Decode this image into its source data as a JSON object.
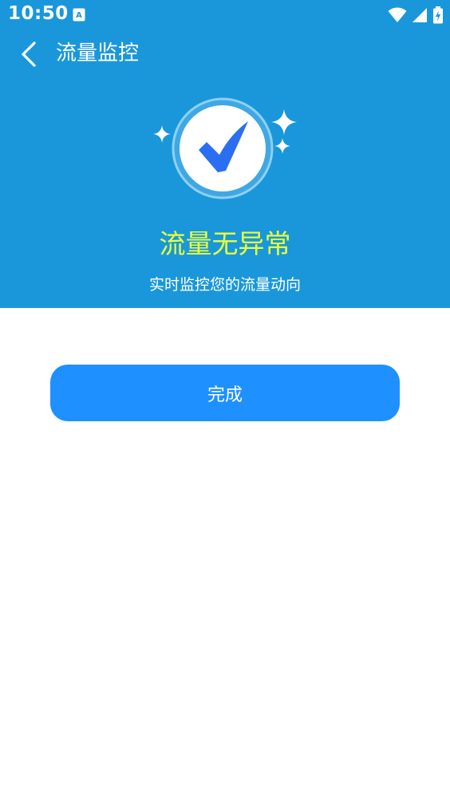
{
  "status_bar": {
    "time": "10:50",
    "app_icon_letter": "A",
    "icons": [
      "wifi-icon",
      "cell-signal-icon",
      "battery-charging-icon"
    ]
  },
  "toolbar": {
    "back_icon": "chevron-left-icon",
    "title": "流量监控"
  },
  "hero": {
    "badge_icon": "checkmark-icon",
    "heading": "流量无异常",
    "subheading": "实时监控您的流量动向"
  },
  "actions": {
    "done_label": "完成"
  },
  "colors": {
    "hero_background": "#1a97db",
    "heading_text": "#e8ff3a",
    "check_mark": "#2a6ff2",
    "button_background": "#1e90ff",
    "page_background": "#ffffff"
  }
}
